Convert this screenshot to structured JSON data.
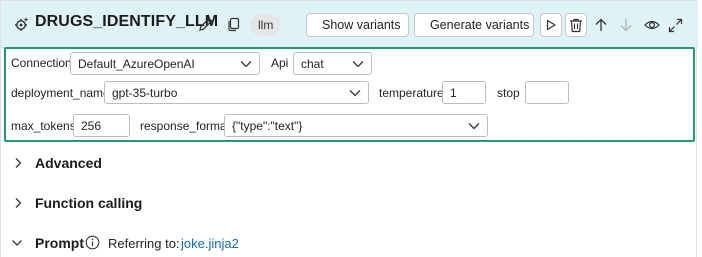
{
  "node": {
    "title": "DRUGS_IDENTIFY_LLM",
    "type_badge": "llm",
    "show_variants_label": "Show variants",
    "generate_variants_label": "Generate variants"
  },
  "params": {
    "connection": {
      "label": "Connection",
      "value": "Default_AzureOpenAI"
    },
    "api": {
      "label": "Api",
      "value": "chat"
    },
    "deployment_name": {
      "label": "deployment_name",
      "value": "gpt-35-turbo"
    },
    "temperature": {
      "label": "temperature",
      "value": "1"
    },
    "stop": {
      "label": "stop",
      "value": ""
    },
    "max_tokens": {
      "label": "max_tokens",
      "value": "256"
    },
    "response_format": {
      "label": "response_format",
      "value": "{\"type\":\"text\"}"
    }
  },
  "sections": {
    "advanced": "Advanced",
    "function_calling": "Function calling",
    "prompt": "Prompt",
    "referring_label": "Referring to:",
    "referring_link": "joke.jinja2"
  },
  "colors": {
    "header_bg": "#dff2f6",
    "highlight_border": "#1f9d6b",
    "link": "#0f6cbd"
  }
}
